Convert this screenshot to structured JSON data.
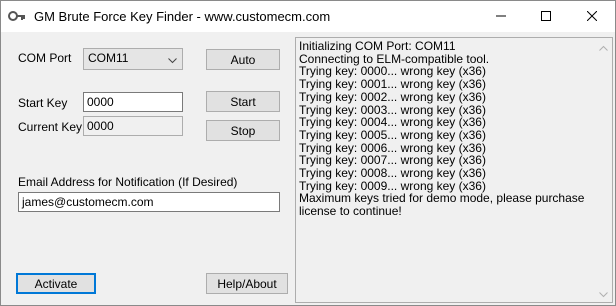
{
  "window": {
    "title": "GM Brute Force Key Finder - www.customecm.com"
  },
  "form": {
    "com_port_label": "COM Port",
    "com_port_value": "COM11",
    "auto_button": "Auto",
    "start_key_label": "Start Key",
    "start_key_value": "0000",
    "start_button": "Start",
    "current_key_label": "Current Key",
    "current_key_value": "0000",
    "stop_button": "Stop",
    "email_label": "Email Address for Notification (If Desired)",
    "email_value": "james@customecm.com",
    "activate_button": "Activate",
    "help_button": "Help/About"
  },
  "log": {
    "lines": [
      "Initializing COM Port: COM11",
      "Connecting to ELM-compatible tool.",
      "Trying key: 0000... wrong key (x36)",
      "Trying key: 0001... wrong key (x36)",
      "Trying key: 0002... wrong key (x36)",
      "Trying key: 0003... wrong key (x36)",
      "Trying key: 0004... wrong key (x36)",
      "Trying key: 0005... wrong key (x36)",
      "Trying key: 0006... wrong key (x36)",
      "Trying key: 0007... wrong key (x36)",
      "Trying key: 0008... wrong key (x36)",
      "Trying key: 0009... wrong key (x36)",
      "Maximum keys tried for demo mode, please purchase license to continue!"
    ]
  },
  "icons": {
    "app": "key-icon",
    "minimize": "minimize-icon",
    "maximize": "maximize-icon",
    "close": "close-icon"
  },
  "colors": {
    "default_button_border": "#0078d7"
  }
}
